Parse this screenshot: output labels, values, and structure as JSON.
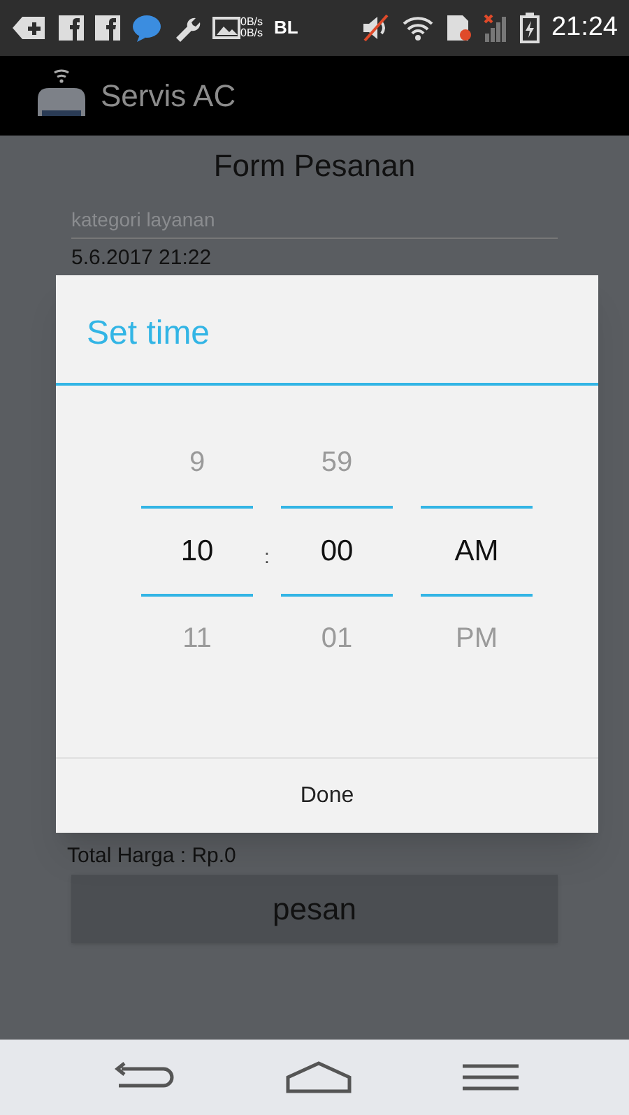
{
  "status_bar": {
    "network_speed": [
      "0B/s",
      "0B/s"
    ],
    "label": "BL",
    "time": "21:24"
  },
  "app_bar": {
    "title": "Servis AC"
  },
  "form": {
    "heading": "Form Pesanan",
    "category_placeholder": "kategori layanan",
    "datetime": "5.6.2017 21:22",
    "total": "Total Harga : Rp.0",
    "order_button": "pesan"
  },
  "time_dialog": {
    "title": "Set time",
    "separator": ":",
    "columns": [
      {
        "above": "9",
        "value": "10",
        "below": "11"
      },
      {
        "above": "59",
        "value": "00",
        "below": "01"
      },
      {
        "value": "AM",
        "below": "PM"
      }
    ],
    "done": "Done"
  }
}
